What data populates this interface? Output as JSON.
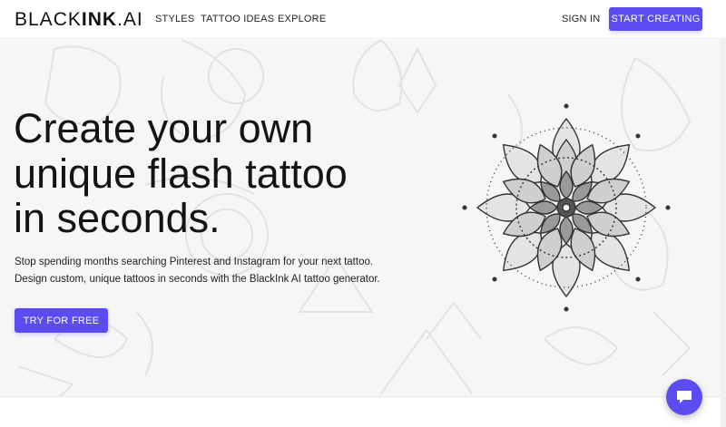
{
  "brand": {
    "logo_light": "BLACK",
    "logo_bold": "INK",
    "logo_suffix": ".AI"
  },
  "nav": {
    "links": [
      "STYLES",
      "TATTOO IDEAS",
      "EXPLORE"
    ],
    "sign_in": "SIGN IN",
    "cta": "START CREATING"
  },
  "hero": {
    "headline_lines": [
      "Create your own",
      "unique flash tattoo",
      "in seconds."
    ],
    "subtitle_lines": [
      "Stop spending months searching Pinterest and Instagram for your next tattoo.",
      "Design custom, unique tattoos in seconds with the BlackInk AI tattoo generator."
    ],
    "cta": "TRY FOR FREE",
    "image": "mandala-tattoo-illustration"
  },
  "chat_widget": {
    "icon": "chat-bubble-icon"
  },
  "colors": {
    "accent": "#5a4cf0",
    "text": "#141414",
    "background": "#ffffff"
  }
}
